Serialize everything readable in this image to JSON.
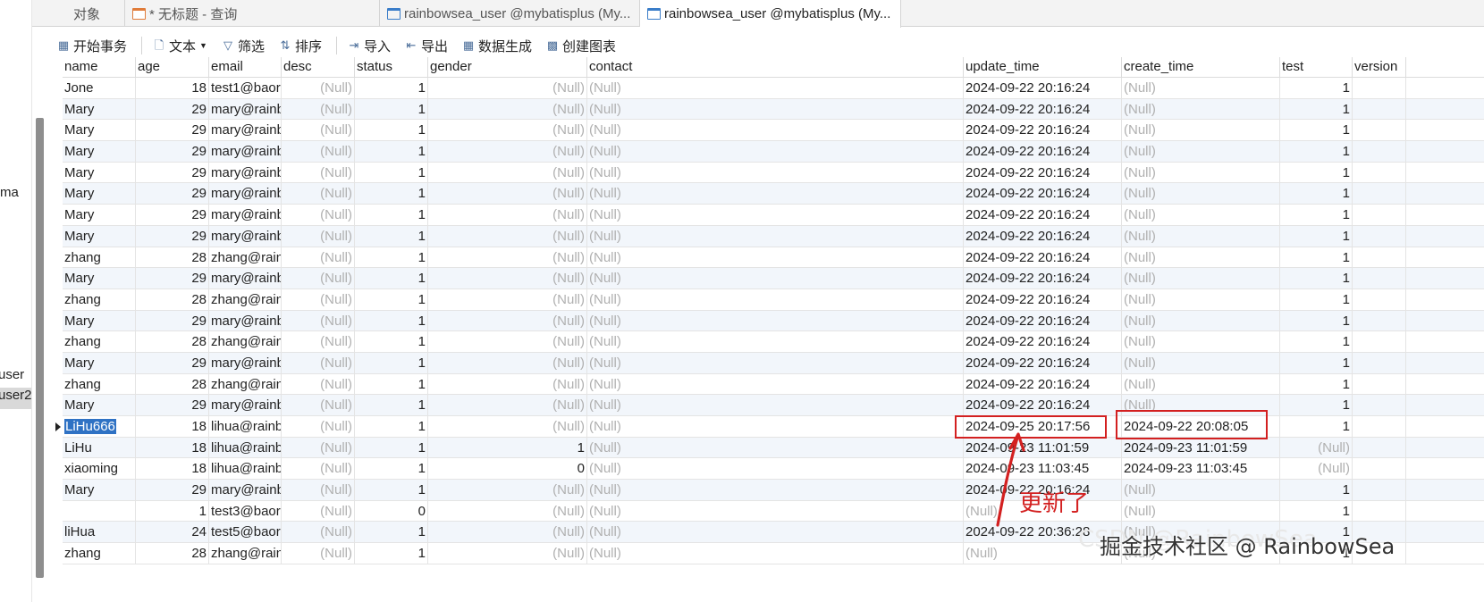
{
  "nav": {
    "items": [
      "ma",
      "user",
      "user2"
    ]
  },
  "tabs": [
    {
      "label": "对象"
    },
    {
      "label": "* 无标题 - 查询"
    },
    {
      "label": "rainbowsea_user @mybatisplus (My..."
    },
    {
      "label": "rainbowsea_user @mybatisplus (My..."
    }
  ],
  "toolbar": {
    "begin_transaction": "开始事务",
    "text": "文本",
    "filter": "筛选",
    "sort": "排序",
    "import": "导入",
    "export": "导出",
    "data_generation": "数据生成",
    "create_chart": "创建图表"
  },
  "grid": {
    "columns": [
      "name",
      "age",
      "email",
      "desc",
      "status",
      "gender",
      "contact",
      "update_time",
      "create_time",
      "test",
      "version"
    ],
    "rows": [
      [
        "Jone",
        "18",
        "test1@baor",
        "(Null)",
        "1",
        "(Null)",
        "(Null)",
        "2024-09-22 20:16:24",
        "(Null)",
        "1",
        ""
      ],
      [
        "Mary",
        "29",
        "mary@rainb",
        "(Null)",
        "1",
        "(Null)",
        "(Null)",
        "2024-09-22 20:16:24",
        "(Null)",
        "1",
        ""
      ],
      [
        "Mary",
        "29",
        "mary@rainb",
        "(Null)",
        "1",
        "(Null)",
        "(Null)",
        "2024-09-22 20:16:24",
        "(Null)",
        "1",
        ""
      ],
      [
        "Mary",
        "29",
        "mary@rainb",
        "(Null)",
        "1",
        "(Null)",
        "(Null)",
        "2024-09-22 20:16:24",
        "(Null)",
        "1",
        ""
      ],
      [
        "Mary",
        "29",
        "mary@rainb",
        "(Null)",
        "1",
        "(Null)",
        "(Null)",
        "2024-09-22 20:16:24",
        "(Null)",
        "1",
        ""
      ],
      [
        "Mary",
        "29",
        "mary@rainb",
        "(Null)",
        "1",
        "(Null)",
        "(Null)",
        "2024-09-22 20:16:24",
        "(Null)",
        "1",
        ""
      ],
      [
        "Mary",
        "29",
        "mary@rainb",
        "(Null)",
        "1",
        "(Null)",
        "(Null)",
        "2024-09-22 20:16:24",
        "(Null)",
        "1",
        ""
      ],
      [
        "Mary",
        "29",
        "mary@rainb",
        "(Null)",
        "1",
        "(Null)",
        "(Null)",
        "2024-09-22 20:16:24",
        "(Null)",
        "1",
        ""
      ],
      [
        "zhang",
        "28",
        "zhang@rain",
        "(Null)",
        "1",
        "(Null)",
        "(Null)",
        "2024-09-22 20:16:24",
        "(Null)",
        "1",
        ""
      ],
      [
        "Mary",
        "29",
        "mary@rainb",
        "(Null)",
        "1",
        "(Null)",
        "(Null)",
        "2024-09-22 20:16:24",
        "(Null)",
        "1",
        ""
      ],
      [
        "zhang",
        "28",
        "zhang@rain",
        "(Null)",
        "1",
        "(Null)",
        "(Null)",
        "2024-09-22 20:16:24",
        "(Null)",
        "1",
        ""
      ],
      [
        "Mary",
        "29",
        "mary@rainb",
        "(Null)",
        "1",
        "(Null)",
        "(Null)",
        "2024-09-22 20:16:24",
        "(Null)",
        "1",
        ""
      ],
      [
        "zhang",
        "28",
        "zhang@rain",
        "(Null)",
        "1",
        "(Null)",
        "(Null)",
        "2024-09-22 20:16:24",
        "(Null)",
        "1",
        ""
      ],
      [
        "Mary",
        "29",
        "mary@rainb",
        "(Null)",
        "1",
        "(Null)",
        "(Null)",
        "2024-09-22 20:16:24",
        "(Null)",
        "1",
        ""
      ],
      [
        "zhang",
        "28",
        "zhang@rain",
        "(Null)",
        "1",
        "(Null)",
        "(Null)",
        "2024-09-22 20:16:24",
        "(Null)",
        "1",
        ""
      ],
      [
        "Mary",
        "29",
        "mary@rainb",
        "(Null)",
        "1",
        "(Null)",
        "(Null)",
        "2024-09-22 20:16:24",
        "(Null)",
        "1",
        ""
      ],
      [
        "LiHu666",
        "18",
        "lihua@rainb",
        "(Null)",
        "1",
        "(Null)",
        "(Null)",
        "2024-09-25 20:17:56",
        "2024-09-22 20:08:05",
        "1",
        ""
      ],
      [
        "LiHu",
        "18",
        "lihua@rainb",
        "(Null)",
        "1",
        "1",
        "(Null)",
        "2024-09-23 11:01:59",
        "2024-09-23 11:01:59",
        "(Null)",
        ""
      ],
      [
        "xiaoming",
        "18",
        "lihua@rainb",
        "(Null)",
        "1",
        "0",
        "(Null)",
        "2024-09-23 11:03:45",
        "2024-09-23 11:03:45",
        "(Null)",
        ""
      ],
      [
        "Mary",
        "29",
        "mary@rainb",
        "(Null)",
        "1",
        "(Null)",
        "(Null)",
        "2024-09-22 20:16:24",
        "(Null)",
        "1",
        ""
      ],
      [
        "",
        "1",
        "test3@baor",
        "(Null)",
        "0",
        "(Null)",
        "(Null)",
        "(Null)",
        "(Null)",
        "1",
        ""
      ],
      [
        "liHua",
        "24",
        "test5@baor",
        "(Null)",
        "1",
        "(Null)",
        "(Null)",
        "2024-09-22 20:36:28",
        "(Null)",
        "1",
        ""
      ],
      [
        "zhang",
        "28",
        "zhang@rain",
        "(Null)",
        "1",
        "(Null)",
        "(Null)",
        "(Null)",
        "(Null)",
        "1",
        ""
      ]
    ],
    "selected_row": 16
  },
  "annotation": {
    "label": "更新了",
    "color": "#d32020"
  },
  "watermark": {
    "text": "CSDN @RainbowSea",
    "owner": "掘金技术社区 @ RainbowSea"
  },
  "colors": {
    "selection": "#2f72c4",
    "null_text": "#b0b0b0",
    "alt_row": "#f2f6fb"
  }
}
